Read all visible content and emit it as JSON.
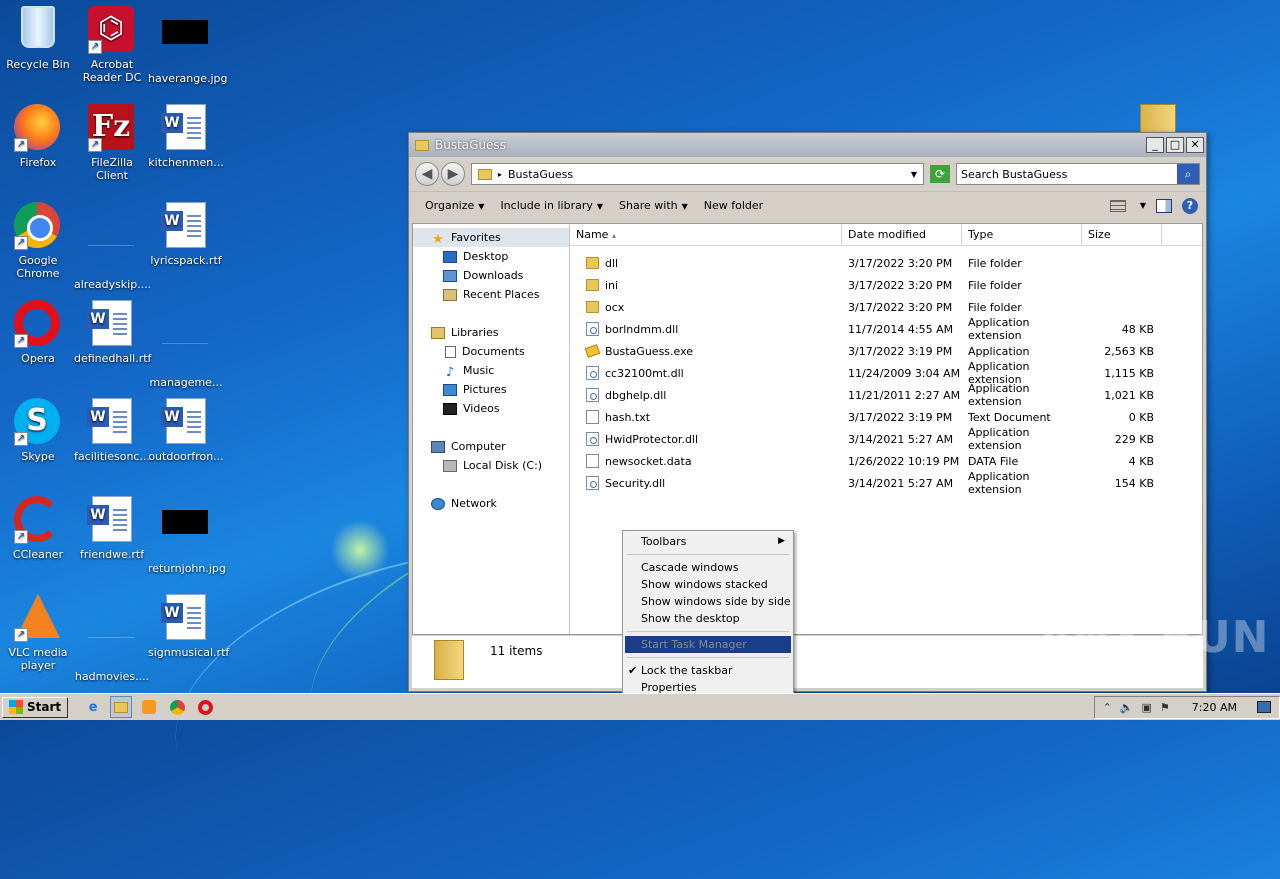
{
  "desktop": {
    "icons": [
      {
        "label": "Recycle Bin",
        "icon": "recycle-bin-icon"
      },
      {
        "label": "Acrobat Reader DC",
        "icon": "acrobat-icon"
      },
      {
        "label": "haverange.jpg",
        "icon": "image-file-icon"
      },
      {
        "label": "Firefox",
        "icon": "firefox-icon"
      },
      {
        "label": "FileZilla Client",
        "icon": "filezilla-icon"
      },
      {
        "label": "kitchenmen...",
        "icon": "word-document-icon"
      },
      {
        "label": "Google Chrome",
        "icon": "chrome-icon"
      },
      {
        "label": "alreadyskip....",
        "icon": "file-icon"
      },
      {
        "label": "lyricspack.rtf",
        "icon": "word-document-icon"
      },
      {
        "label": "Opera",
        "icon": "opera-icon"
      },
      {
        "label": "definedhall.rtf",
        "icon": "word-document-icon"
      },
      {
        "label": "manageme...",
        "icon": "file-icon"
      },
      {
        "label": "Skype",
        "icon": "skype-icon"
      },
      {
        "label": "facilitiesonc...",
        "icon": "word-document-icon"
      },
      {
        "label": "outdoorfron...",
        "icon": "word-document-icon"
      },
      {
        "label": "CCleaner",
        "icon": "ccleaner-icon"
      },
      {
        "label": "friendwe.rtf",
        "icon": "word-document-icon"
      },
      {
        "label": "returnjohn.jpg",
        "icon": "image-file-icon"
      },
      {
        "label": "VLC media player",
        "icon": "vlc-icon"
      },
      {
        "label": "hadmovies....",
        "icon": "file-icon"
      },
      {
        "label": "signmusical.rtf",
        "icon": "word-document-icon"
      }
    ],
    "watermark": "ANY RUN"
  },
  "window": {
    "title": "BustaGuess",
    "address": "BustaGuess",
    "search_placeholder": "Search BustaGuess",
    "toolbar": {
      "organize": "Organize",
      "include": "Include in library",
      "share": "Share with",
      "new_folder": "New folder"
    },
    "nav": {
      "favorites": "Favorites",
      "desktop": "Desktop",
      "downloads": "Downloads",
      "recent": "Recent Places",
      "libraries": "Libraries",
      "documents": "Documents",
      "music": "Music",
      "pictures": "Pictures",
      "videos": "Videos",
      "computer": "Computer",
      "local_disk": "Local Disk (C:)",
      "network": "Network"
    },
    "columns": {
      "name": "Name",
      "date": "Date modified",
      "type": "Type",
      "size": "Size"
    },
    "files": [
      {
        "name": "dll",
        "date": "3/17/2022 3:20 PM",
        "type": "File folder",
        "size": "",
        "kind": "folder"
      },
      {
        "name": "ini",
        "date": "3/17/2022 3:20 PM",
        "type": "File folder",
        "size": "",
        "kind": "folder"
      },
      {
        "name": "ocx",
        "date": "3/17/2022 3:20 PM",
        "type": "File folder",
        "size": "",
        "kind": "folder"
      },
      {
        "name": "borlndmm.dll",
        "date": "11/7/2014 4:55 AM",
        "type": "Application extension",
        "size": "48 KB",
        "kind": "dll"
      },
      {
        "name": "BustaGuess.exe",
        "date": "3/17/2022 3:19 PM",
        "type": "Application",
        "size": "2,563 KB",
        "kind": "exe"
      },
      {
        "name": "cc32100mt.dll",
        "date": "11/24/2009 3:04 AM",
        "type": "Application extension",
        "size": "1,115 KB",
        "kind": "dll"
      },
      {
        "name": "dbghelp.dll",
        "date": "11/21/2011 2:27 AM",
        "type": "Application extension",
        "size": "1,021 KB",
        "kind": "dll"
      },
      {
        "name": "hash.txt",
        "date": "3/17/2022 3:19 PM",
        "type": "Text Document",
        "size": "0 KB",
        "kind": "txt"
      },
      {
        "name": "HwidProtector.dll",
        "date": "3/14/2021 5:27 AM",
        "type": "Application extension",
        "size": "229 KB",
        "kind": "dll"
      },
      {
        "name": "newsocket.data",
        "date": "1/26/2022 10:19 PM",
        "type": "DATA File",
        "size": "4 KB",
        "kind": "data"
      },
      {
        "name": "Security.dll",
        "date": "3/14/2021 5:27 AM",
        "type": "Application extension",
        "size": "154 KB",
        "kind": "dll"
      }
    ],
    "item_count": "11 items"
  },
  "context_menu": {
    "toolbars": "Toolbars",
    "cascade": "Cascade windows",
    "stacked": "Show windows stacked",
    "side_by_side": "Show windows side by side",
    "show_desktop": "Show the desktop",
    "task_manager": "Start Task Manager",
    "lock": "Lock the taskbar",
    "properties": "Properties"
  },
  "taskbar": {
    "start": "Start",
    "clock": "7:20 AM"
  }
}
